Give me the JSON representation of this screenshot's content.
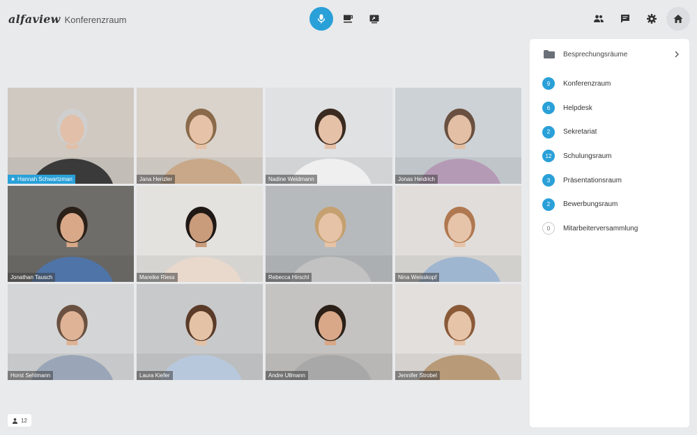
{
  "app": {
    "logo": "alfaview",
    "room_title": "Konferenzraum"
  },
  "toolbar": {
    "center": [
      {
        "icon": "microphone-icon",
        "active": true
      },
      {
        "icon": "coffee-break-icon",
        "active": false
      },
      {
        "icon": "screen-share-icon",
        "active": false
      }
    ],
    "right": [
      {
        "icon": "participants-icon"
      },
      {
        "icon": "chat-icon"
      },
      {
        "icon": "settings-gear-icon"
      },
      {
        "icon": "home-icon"
      }
    ]
  },
  "participants": [
    {
      "name": "Hannah Schwartzman",
      "speaker": true,
      "bg": "#cfc9c2",
      "shirt": "#3b3a3a",
      "skin": "#e2bfa8",
      "hair": "#cfcfcf"
    },
    {
      "name": "Jana Henzler",
      "speaker": false,
      "bg": "#d9d3cc",
      "shirt": "#c8a888",
      "skin": "#e6c3a8",
      "hair": "#8a6a4a"
    },
    {
      "name": "Nadine Weidmann",
      "speaker": false,
      "bg": "#dfe1e3",
      "shirt": "#efefef",
      "skin": "#e5c1a8",
      "hair": "#3a2a20"
    },
    {
      "name": "Jonas Heidrich",
      "speaker": false,
      "bg": "#cdd2d6",
      "shirt": "#b59ab5",
      "skin": "#e3c0a5",
      "hair": "#6a5040"
    },
    {
      "name": "Jonathan Tausch",
      "speaker": false,
      "bg": "#6f6d6a",
      "shirt": "#4f74a8",
      "skin": "#d8a888",
      "hair": "#2a2018"
    },
    {
      "name": "Mareike Riess",
      "speaker": false,
      "bg": "#e4e2df",
      "shirt": "#e9d8cc",
      "skin": "#c99c7c",
      "hair": "#1f1814"
    },
    {
      "name": "Rebecca Hirschl",
      "speaker": false,
      "bg": "#b7babd",
      "shirt": "#c2c2c2",
      "skin": "#e6c2a6",
      "hair": "#c5a070"
    },
    {
      "name": "Nina Weisskopf",
      "speaker": false,
      "bg": "#e0ddda",
      "shirt": "#9fb6d0",
      "skin": "#e6c4aa",
      "hair": "#b07850"
    },
    {
      "name": "Horst Sehlmann",
      "speaker": false,
      "bg": "#d4d5d6",
      "shirt": "#9aa6b8",
      "skin": "#deb396",
      "hair": "#6a5040"
    },
    {
      "name": "Laura Kiefer",
      "speaker": false,
      "bg": "#c8c9ca",
      "shirt": "#b8c8dc",
      "skin": "#e4c2a6",
      "hair": "#5a3a28"
    },
    {
      "name": "Andre Ullmann",
      "speaker": false,
      "bg": "#c4c3c1",
      "shirt": "#a8a8a8",
      "skin": "#d8a888",
      "hair": "#2a2018"
    },
    {
      "name": "Jennifer Strobel",
      "speaker": false,
      "bg": "#e2dfdc",
      "shirt": "#b89a78",
      "skin": "#e6c4a8",
      "hair": "#8a5a38"
    }
  ],
  "participant_count": "12",
  "panel": {
    "header": "Besprechungsräume",
    "rooms": [
      {
        "count": "9",
        "name": "Konferenzraum",
        "empty": false
      },
      {
        "count": "6",
        "name": "Helpdesk",
        "empty": false
      },
      {
        "count": "2",
        "name": "Sekretariat",
        "empty": false
      },
      {
        "count": "12",
        "name": "Schulungsraum",
        "empty": false
      },
      {
        "count": "3",
        "name": "Präsentationsraum",
        "empty": false
      },
      {
        "count": "2",
        "name": "Bewerbungsraum",
        "empty": false
      },
      {
        "count": "0",
        "name": "Mitarbeiterversammlung",
        "empty": true
      }
    ]
  },
  "colors": {
    "accent": "#2aa0d8",
    "background": "#e9eaec",
    "panel": "#ffffff"
  }
}
